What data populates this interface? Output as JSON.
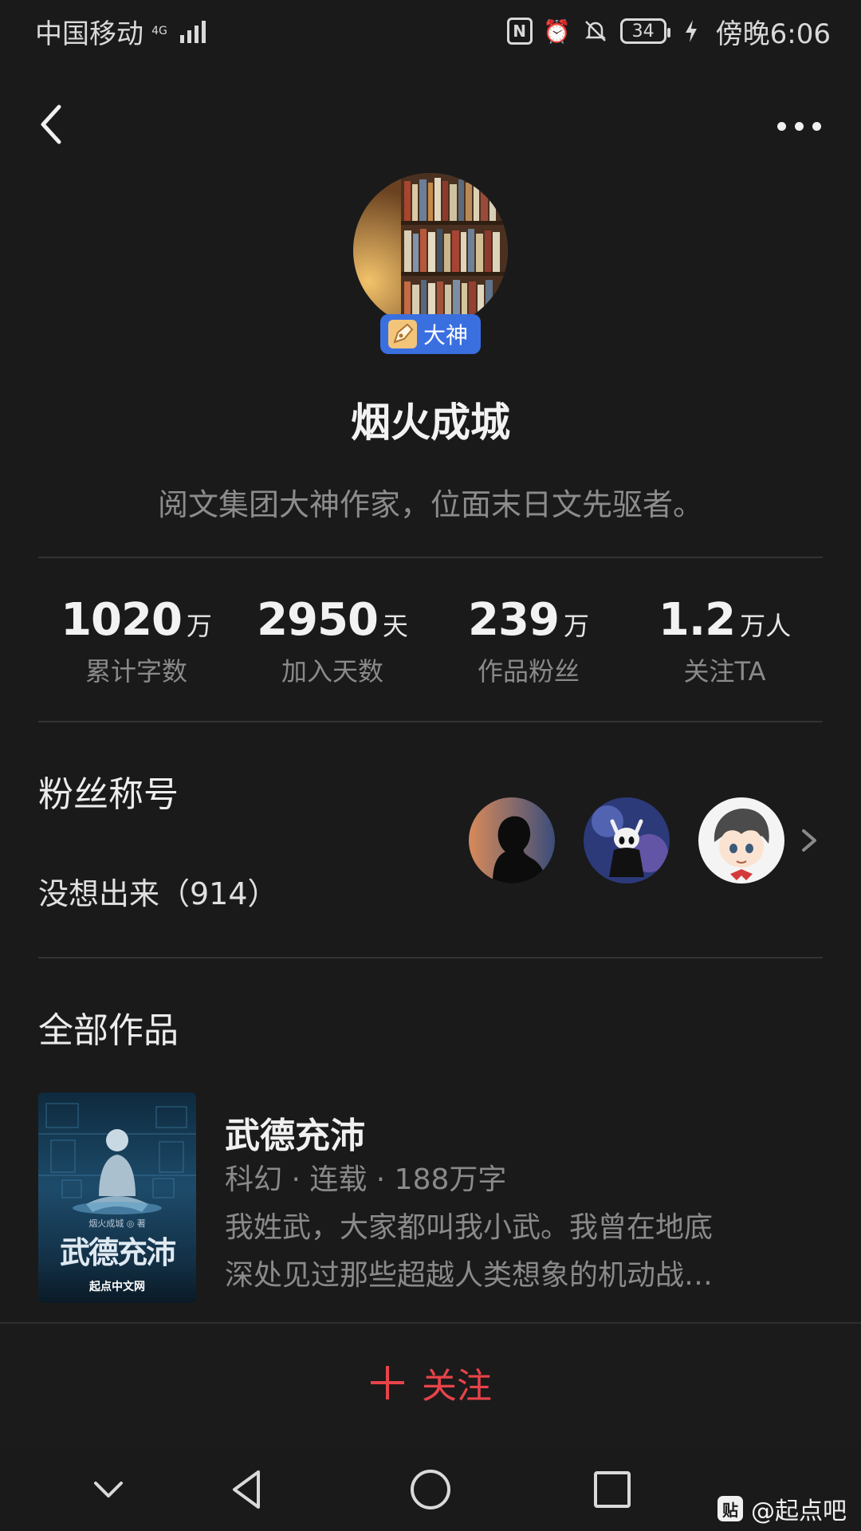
{
  "status_bar": {
    "carrier": "中国移动",
    "network": "4G",
    "battery": "34",
    "time": "傍晚6:06"
  },
  "author": {
    "badge": "大神",
    "name": "烟火成城",
    "bio": "阅文集团大神作家，位面末日文先驱者。"
  },
  "stats": [
    {
      "value": "1020",
      "unit": "万",
      "label": "累计字数"
    },
    {
      "value": "2950",
      "unit": "天",
      "label": "加入天数"
    },
    {
      "value": "239",
      "unit": "万",
      "label": "作品粉丝"
    },
    {
      "value": "1.2",
      "unit": "万人",
      "label": "关注TA"
    }
  ],
  "fans": {
    "title": "粉丝称号",
    "name": "没想出来（914）"
  },
  "works": {
    "title": "全部作品",
    "books": [
      {
        "title": "武德充沛",
        "meta": "科幻 · 连载 · 188万字",
        "desc_line1": "我姓武，大家都叫我小武。我曾在地底",
        "desc_line2": "深处见过那些超越人类想象的机动战…",
        "cover_title": "武德充沛",
        "cover_author": "烟火成城 ◎ 著",
        "cover_site": "起点中文网"
      }
    ]
  },
  "follow": {
    "label": "关注"
  },
  "watermark": {
    "logo": "贴",
    "text": "@起点吧"
  },
  "colors": {
    "accent": "#e8434a",
    "badge": "#3a6fe0",
    "background": "#1a1a1a"
  }
}
